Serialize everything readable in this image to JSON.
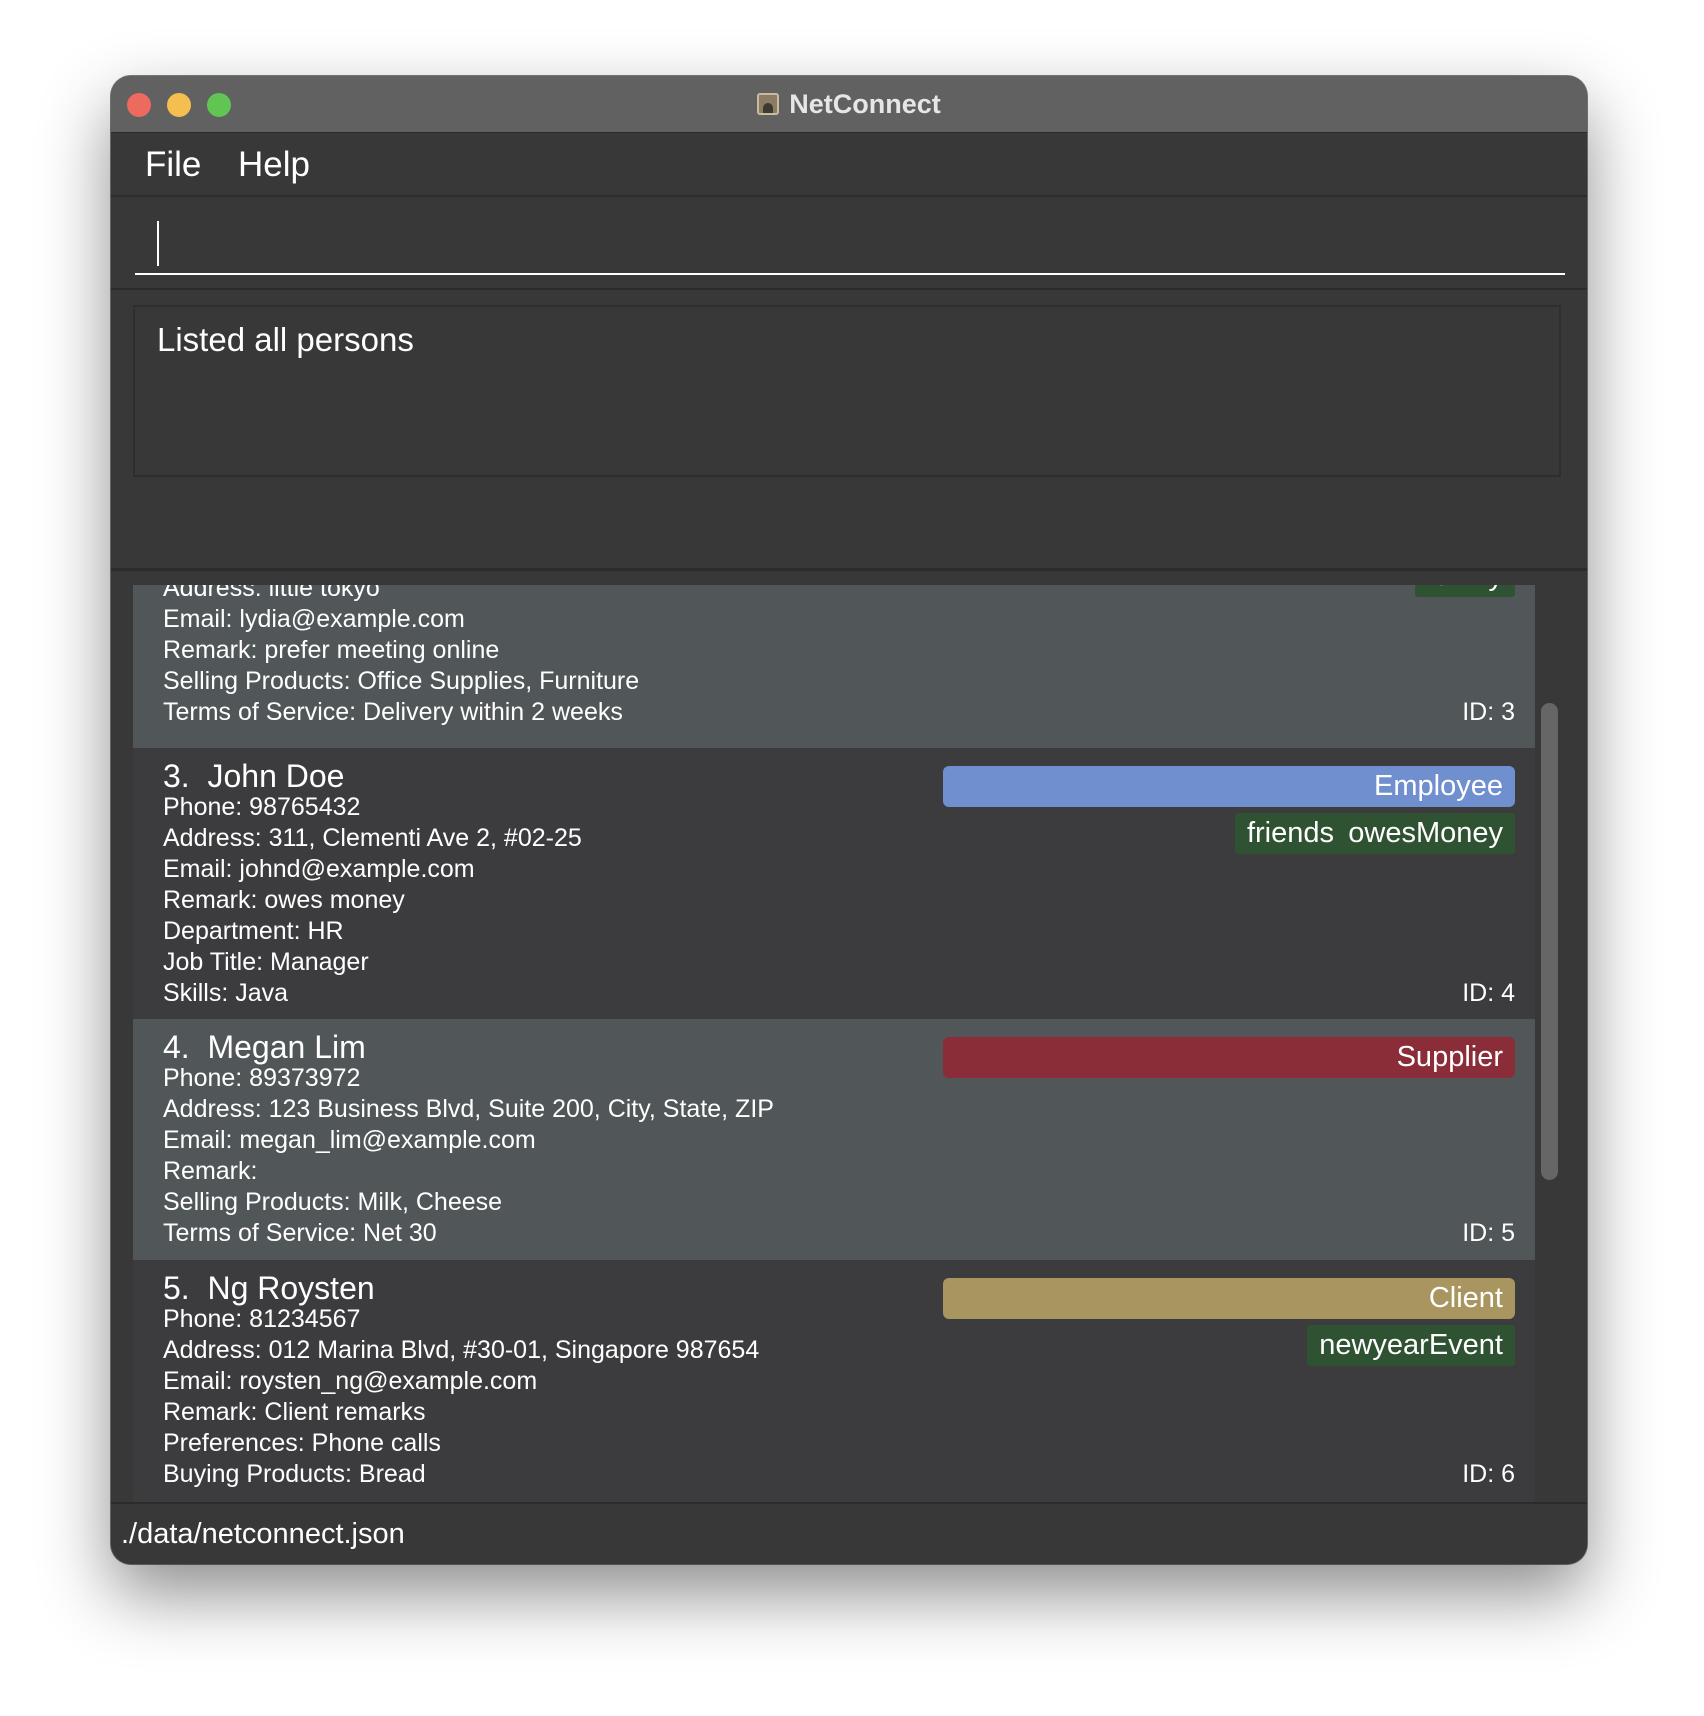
{
  "window": {
    "title": "NetConnect"
  },
  "menu": {
    "file": "File",
    "help": "Help"
  },
  "command": {
    "value": ""
  },
  "result": {
    "text": "Listed all persons"
  },
  "persons": {
    "p2": {
      "address": "Address: little tokyo",
      "tag": "family",
      "email": "Email: lydia@example.com",
      "remark": "Remark: prefer meeting online",
      "selling": "Selling Products: Office Supplies, Furniture",
      "terms": "Terms of Service: Delivery within 2 weeks",
      "id": "ID: 3"
    },
    "p3": {
      "index": "3.",
      "name": "John Doe",
      "type": "Employee",
      "type_color": "#6f8fcf",
      "tags": [
        "friends",
        "owesMoney"
      ],
      "phone": "Phone: 98765432",
      "address": "Address: 311, Clementi Ave 2, #02-25",
      "email": "Email: johnd@example.com",
      "remark": "Remark: owes money",
      "department": "Department: HR",
      "job": "Job Title: Manager",
      "skills": "Skills: Java",
      "id": "ID: 4"
    },
    "p4": {
      "index": "4.",
      "name": "Megan Lim",
      "type": "Supplier",
      "type_color": "#8b2c39",
      "phone": "Phone: 89373972",
      "address": "Address: 123 Business Blvd, Suite 200, City, State, ZIP",
      "email": "Email: megan_lim@example.com",
      "remark": "Remark:",
      "selling": "Selling Products: Milk, Cheese",
      "terms": "Terms of Service: Net 30",
      "id": "ID: 5"
    },
    "p5": {
      "index": "5.",
      "name": "Ng Roysten",
      "type": "Client",
      "type_color": "#a99560",
      "tags": [
        "newyearEvent"
      ],
      "phone": "Phone: 81234567",
      "address": "Address: 012 Marina Blvd, #30-01, Singapore 987654",
      "email": "Email: roysten_ng@example.com",
      "remark": "Remark: Client remarks",
      "preferences": "Preferences: Phone calls",
      "buying": "Buying Products: Bread",
      "id": "ID: 6"
    }
  },
  "status": {
    "path": "./data/netconnect.json"
  },
  "colors": {
    "tag_bg": "#2f5233",
    "card_light": "#515658",
    "card_dark": "#3c3c3e",
    "window_bg": "#383838"
  }
}
